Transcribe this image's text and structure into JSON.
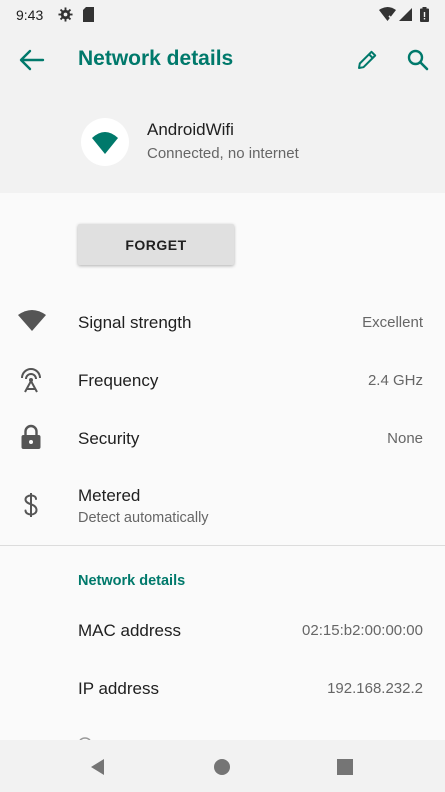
{
  "status_bar": {
    "time": "9:43",
    "icons": [
      "settings-gear-icon",
      "sd-card-icon",
      "wifi-x-icon",
      "cellular-signal-icon",
      "battery-icon"
    ]
  },
  "app_bar": {
    "title": "Network details",
    "actions": [
      "back-arrow-icon",
      "edit-pencil-icon",
      "search-icon"
    ]
  },
  "network": {
    "name": "AndroidWifi",
    "status": "Connected, no internet"
  },
  "forget_button": {
    "label": "FORGET"
  },
  "details": [
    {
      "icon": "wifi-signal-icon",
      "label": "Signal strength",
      "value": "Excellent"
    },
    {
      "icon": "antenna-frequency-icon",
      "label": "Frequency",
      "value": "2.4 GHz"
    },
    {
      "icon": "lock-icon",
      "label": "Security",
      "value": "None"
    },
    {
      "icon": "dollar-icon",
      "label": "Metered",
      "sublabel": "Detect automatically"
    }
  ],
  "network_details_section": {
    "header": "Network details",
    "rows": [
      {
        "label": "MAC address",
        "value": "02:15:b2:00:00:00"
      },
      {
        "label": "IP address",
        "value": "192.168.232.2"
      }
    ]
  },
  "navigation": [
    "back-triangle-icon",
    "home-circle-icon",
    "recents-square-icon"
  ],
  "colors": {
    "accent": "#00796b",
    "background": "#fafafa",
    "header": "#f2f2f2"
  }
}
